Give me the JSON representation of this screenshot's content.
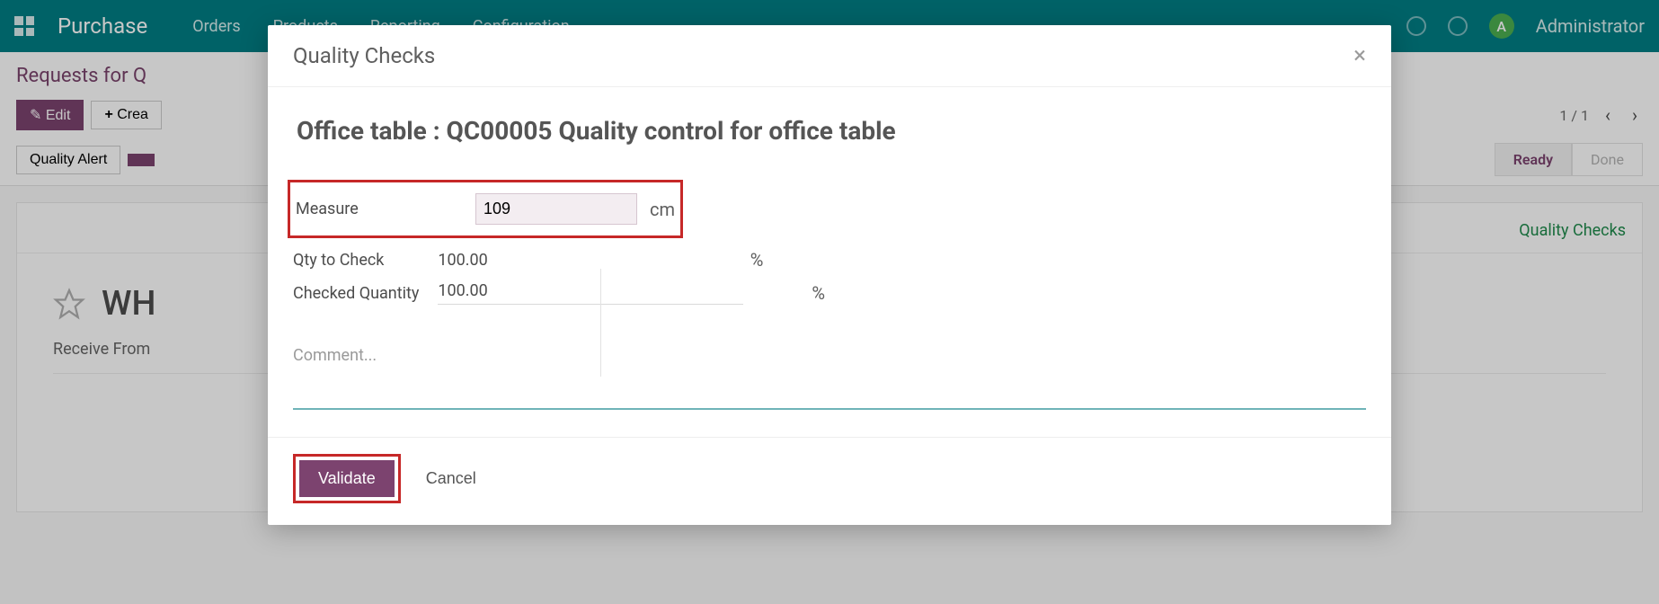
{
  "topbar": {
    "brand": "Purchase",
    "nav": [
      "Orders",
      "Products",
      "Reporting",
      "Configuration"
    ],
    "avatar_initial": "A",
    "username": "Administrator"
  },
  "control": {
    "breadcrumb": "Requests for Q",
    "edit_label": "Edit",
    "create_label": "Crea",
    "quality_alert_label": "Quality Alert",
    "pager_current": "1",
    "pager_total": "1"
  },
  "statusbar": {
    "active": "Ready",
    "done": "Done"
  },
  "sheet": {
    "quality_checks_btn": "Quality Checks",
    "title_prefix": "WH",
    "receive_from_label": "Receive From"
  },
  "modal": {
    "title": "Quality Checks",
    "subtitle": "Office table : QC00005 Quality control for office table",
    "measure_label": "Measure",
    "measure_value": "109",
    "measure_unit": "cm",
    "qty_to_check_label": "Qty to Check",
    "qty_to_check_value": "100.00",
    "checked_qty_label": "Checked Quantity",
    "checked_qty_value": "100.00",
    "pct_symbol": "%",
    "comment_placeholder": "Comment...",
    "validate_label": "Validate",
    "cancel_label": "Cancel"
  }
}
